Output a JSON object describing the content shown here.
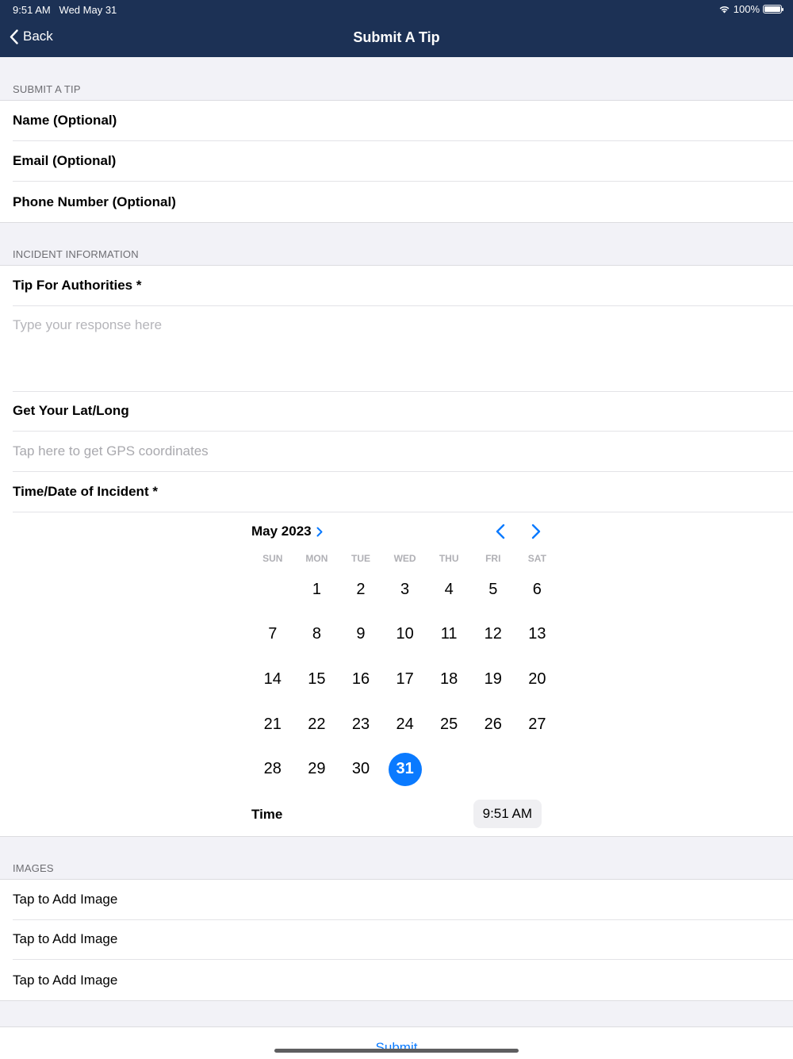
{
  "status": {
    "time": "9:51 AM",
    "date": "Wed May 31",
    "battery": "100%"
  },
  "nav": {
    "back_label": "Back",
    "title": "Submit A Tip"
  },
  "sections": {
    "submit_tip": {
      "header": "SUBMIT A TIP",
      "rows": [
        "Name (Optional)",
        "Email (Optional)",
        "Phone Number (Optional)"
      ]
    },
    "incident": {
      "header": "INCIDENT INFORMATION",
      "tip_label": "Tip For Authorities *",
      "tip_placeholder": "Type your response here",
      "latlong_label": "Get Your Lat/Long",
      "gps_placeholder": "Tap here to get GPS coordinates",
      "datetime_label": "Time/Date of Incident *"
    },
    "images": {
      "header": "IMAGES",
      "rows": [
        "Tap to Add Image",
        "Tap to Add Image",
        "Tap to Add Image"
      ]
    }
  },
  "calendar": {
    "month": "May 2023",
    "weekdays": [
      "SUN",
      "MON",
      "TUE",
      "WED",
      "THU",
      "FRI",
      "SAT"
    ],
    "first_weekday_index": 1,
    "days_in_month": 31,
    "selected_day": 31,
    "time_label": "Time",
    "time_value": "9:51 AM",
    "accent": "#0a7aff"
  },
  "submit_label": "Submit",
  "colors": {
    "nav_bg": "#1c3155",
    "accent": "#0a7aff",
    "background": "#f2f2f7"
  }
}
